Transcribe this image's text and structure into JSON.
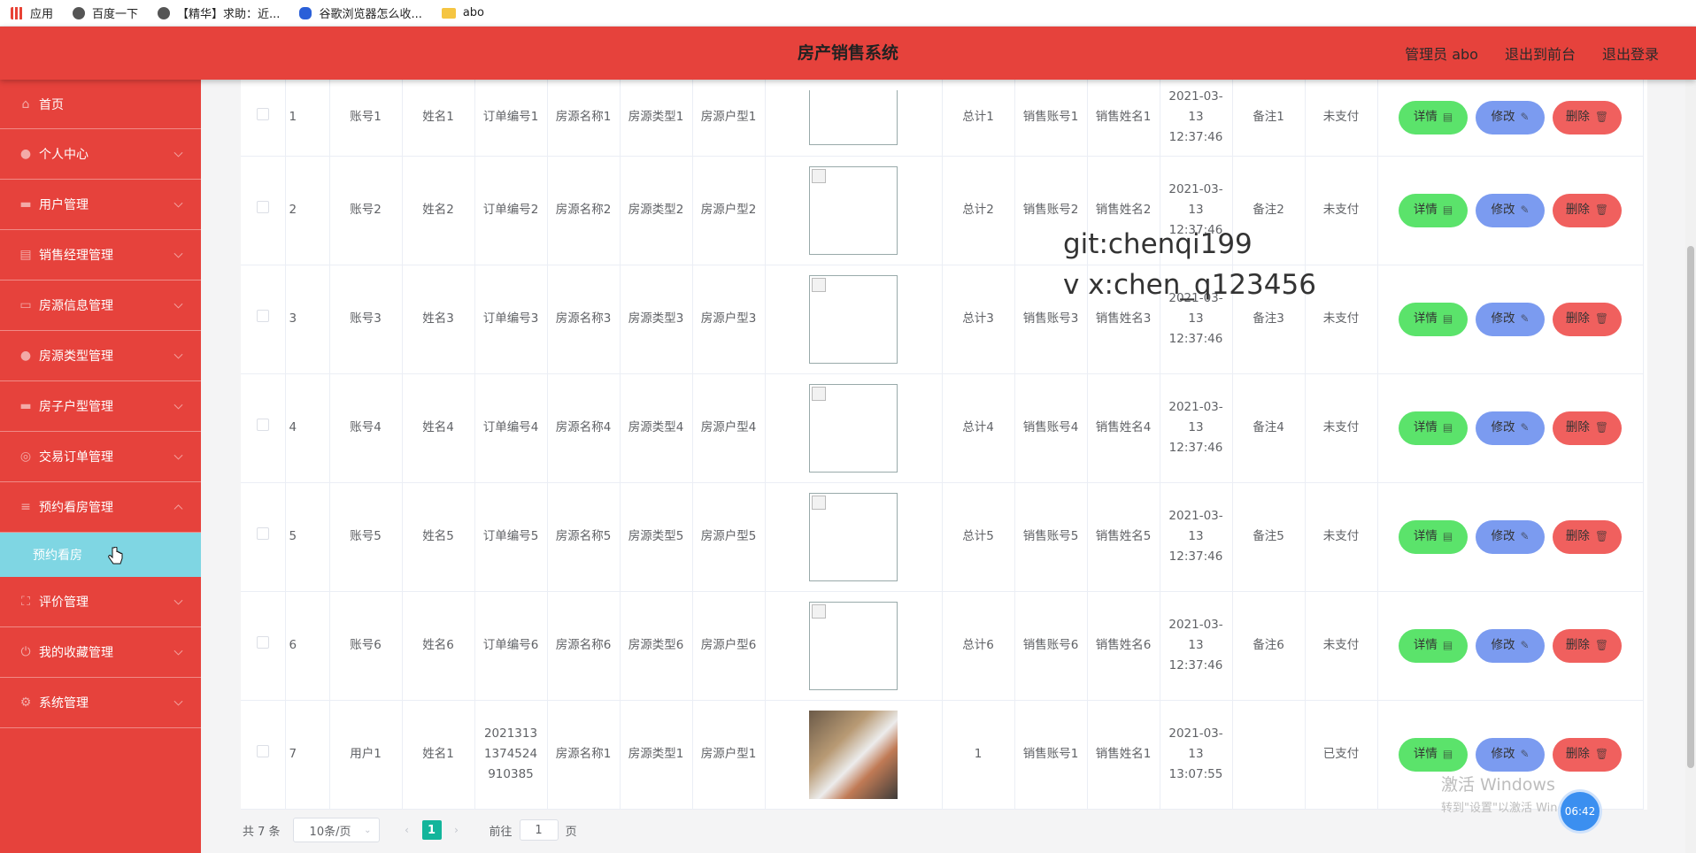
{
  "bookmarks": [
    {
      "label": "应用",
      "icon": "apps-grid-icon"
    },
    {
      "label": "百度一下",
      "icon": "globe-icon"
    },
    {
      "label": "【精华】求助：近...",
      "icon": "globe-icon"
    },
    {
      "label": "谷歌浏览器怎么收...",
      "icon": "baidu-paw-icon"
    },
    {
      "label": "abo",
      "icon": "folder-icon"
    }
  ],
  "header": {
    "title": "房产销售系统",
    "admin": "管理员 abo",
    "back_to_front": "退出到前台",
    "logout": "退出登录",
    "bg_color": "#e6423c"
  },
  "sidebar": {
    "items": [
      {
        "label": "首页",
        "icon": "home-icon"
      },
      {
        "label": "个人中心",
        "icon": "user-icon"
      },
      {
        "label": "用户管理",
        "icon": "monitor-icon"
      },
      {
        "label": "销售经理管理",
        "icon": "clipboard-icon"
      },
      {
        "label": "房源信息管理",
        "icon": "briefcase-icon"
      },
      {
        "label": "房源类型管理",
        "icon": "user-icon"
      },
      {
        "label": "房子户型管理",
        "icon": "monitor-icon"
      },
      {
        "label": "交易订单管理",
        "icon": "order-icon"
      },
      {
        "label": "预约看房管理",
        "icon": "list-icon"
      }
    ],
    "submenu_active": "预约看房",
    "items_after": [
      {
        "label": "评价管理",
        "icon": "fullscreen-icon"
      },
      {
        "label": "我的收藏管理",
        "icon": "power-icon"
      },
      {
        "label": "系统管理",
        "icon": "settings-icon"
      }
    ],
    "active_color": "#7fd6e3"
  },
  "table": {
    "rows": [
      {
        "index": "1",
        "account": "账号1",
        "name": "姓名1",
        "order_no": "订单编号1",
        "house_name": "房源名称1",
        "house_type": "房源类型1",
        "layout": "房源户型1",
        "image": "broken",
        "total": "总计1",
        "sales_account": "销售账号1",
        "sales_name": "销售姓名1",
        "time": "2021-03-13 12:37:46",
        "note": "备注1",
        "status": "未支付"
      },
      {
        "index": "2",
        "account": "账号2",
        "name": "姓名2",
        "order_no": "订单编号2",
        "house_name": "房源名称2",
        "house_type": "房源类型2",
        "layout": "房源户型2",
        "image": "broken",
        "total": "总计2",
        "sales_account": "销售账号2",
        "sales_name": "销售姓名2",
        "time": "2021-03-13 12:37:46",
        "note": "备注2",
        "status": "未支付"
      },
      {
        "index": "3",
        "account": "账号3",
        "name": "姓名3",
        "order_no": "订单编号3",
        "house_name": "房源名称3",
        "house_type": "房源类型3",
        "layout": "房源户型3",
        "image": "broken",
        "total": "总计3",
        "sales_account": "销售账号3",
        "sales_name": "销售姓名3",
        "time": "2021-03-13 12:37:46",
        "note": "备注3",
        "status": "未支付"
      },
      {
        "index": "4",
        "account": "账号4",
        "name": "姓名4",
        "order_no": "订单编号4",
        "house_name": "房源名称4",
        "house_type": "房源类型4",
        "layout": "房源户型4",
        "image": "broken",
        "total": "总计4",
        "sales_account": "销售账号4",
        "sales_name": "销售姓名4",
        "time": "2021-03-13 12:37:46",
        "note": "备注4",
        "status": "未支付"
      },
      {
        "index": "5",
        "account": "账号5",
        "name": "姓名5",
        "order_no": "订单编号5",
        "house_name": "房源名称5",
        "house_type": "房源类型5",
        "layout": "房源户型5",
        "image": "broken",
        "total": "总计5",
        "sales_account": "销售账号5",
        "sales_name": "销售姓名5",
        "time": "2021-03-13 12:37:46",
        "note": "备注5",
        "status": "未支付"
      },
      {
        "index": "6",
        "account": "账号6",
        "name": "姓名6",
        "order_no": "订单编号6",
        "house_name": "房源名称6",
        "house_type": "房源类型6",
        "layout": "房源户型6",
        "image": "broken",
        "total": "总计6",
        "sales_account": "销售账号6",
        "sales_name": "销售姓名6",
        "time": "2021-03-13 12:37:46",
        "note": "备注6",
        "status": "未支付"
      },
      {
        "index": "7",
        "account": "用户1",
        "name": "姓名1",
        "order_no": "2021313 1374524 910385",
        "house_name": "房源名称1",
        "house_type": "房源类型1",
        "layout": "房源户型1",
        "image": "photo",
        "total": "1",
        "sales_account": "销售账号1",
        "sales_name": "销售姓名1",
        "time": "2021-03-13 13:07:55",
        "note": "",
        "status": "已支付"
      }
    ],
    "actions": {
      "detail": "详情",
      "edit": "修改",
      "delete": "删除"
    },
    "colors": {
      "detail": "#5be36b",
      "edit": "#7b9bf0",
      "delete": "#f0605e"
    }
  },
  "pagination": {
    "total": "共 7 条",
    "page_size": "10条/页",
    "current_page": "1",
    "goto_label": "前往",
    "goto_value": "1",
    "goto_suffix": "页",
    "active_color": "#13b59b"
  },
  "watermark": {
    "line1": "git:chenqi199",
    "line2": "v x:chen_q123456"
  },
  "windows_activation": {
    "line1": "激活 Windows",
    "line2": "转到\"设置\"以激活 Windows。"
  },
  "clock": "06:42"
}
